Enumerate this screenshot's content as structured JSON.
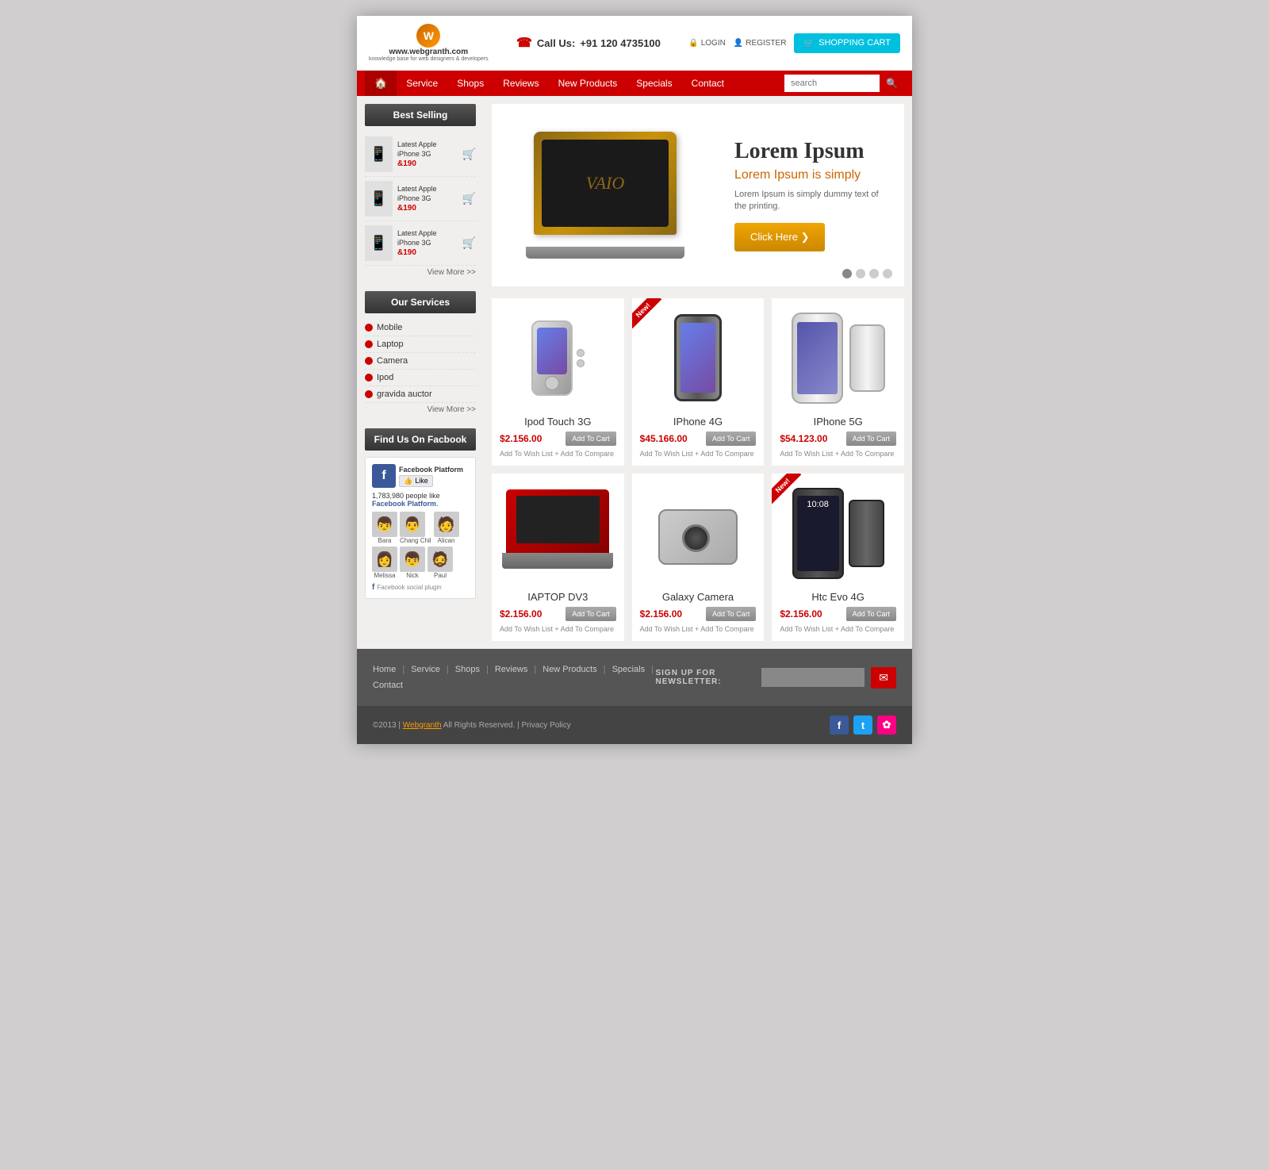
{
  "site": {
    "url": "www.webgranth.com",
    "tagline": "knowledge base for web designers & developers"
  },
  "header": {
    "phone_label": "Call Us:",
    "phone_number": "+91 120 4735100",
    "login_label": "LOGIN",
    "register_label": "REGISTER",
    "cart_label": "SHOPPING CART"
  },
  "nav": {
    "home_icon": "🏠",
    "items": [
      {
        "label": "Service"
      },
      {
        "label": "Shops"
      },
      {
        "label": "Reviews"
      },
      {
        "label": "New Products"
      },
      {
        "label": "Specials"
      },
      {
        "label": "Contact"
      }
    ],
    "search_placeholder": "search"
  },
  "sidebar": {
    "best_selling_title": "Best Selling",
    "products": [
      {
        "name": "Latest Apple iPhone 3G",
        "price": "&190"
      },
      {
        "name": "Latest Apple iPhone 3G",
        "price": "&190"
      },
      {
        "name": "Latest Apple iPhone 3G",
        "price": "&190"
      }
    ],
    "view_more_label": "View More >>",
    "services_title": "Our Services",
    "services": [
      {
        "label": "Mobile"
      },
      {
        "label": "Laptop"
      },
      {
        "label": "Camera"
      },
      {
        "label": "Ipod"
      },
      {
        "label": "gravida auctor"
      }
    ],
    "services_view_more": "View More >>",
    "facebook_section_title": "Find Us On Facbook",
    "facebook": {
      "platform_name": "Facebook Platform",
      "like_label": "Like",
      "count_text": "1,783,980 people like",
      "platform_bold": "Facebook Platform",
      "count_suffix": ".",
      "users": [
        {
          "name": "Bara"
        },
        {
          "name": "Chang Chil"
        },
        {
          "name": "Alican"
        },
        {
          "name": "Melissa"
        },
        {
          "name": "Nick"
        },
        {
          "name": "Paul"
        }
      ],
      "social_plugin_label": "Facebook social plugin"
    }
  },
  "slider": {
    "title": "Lorem Ipsum",
    "subtitle": "Lorem Ipsum is simply",
    "description": "Lorem Ipsum is simply dummy text of the printing.",
    "button_label": "Click Here ❯",
    "laptop_logo": "VAIO",
    "dots": [
      true,
      false,
      false,
      false
    ]
  },
  "products": [
    {
      "id": 1,
      "name": "Ipod Touch 3G",
      "price": "$2.156.00",
      "is_new": false,
      "type": "ipod",
      "add_to_cart": "Add To Cart",
      "wish_list": "Add To Wish List",
      "compare": "+ Add To Compare"
    },
    {
      "id": 2,
      "name": "IPhone 4G",
      "price": "$45.166.00",
      "is_new": true,
      "type": "iphone4",
      "add_to_cart": "Add To Cart",
      "wish_list": "Add To Wish List",
      "compare": "+ Add To Compare"
    },
    {
      "id": 3,
      "name": "IPhone 5G",
      "price": "$54.123.00",
      "is_new": false,
      "type": "iphone5",
      "add_to_cart": "Add To Cart",
      "wish_list": "Add To Wish List",
      "compare": "+ Add To Compare"
    },
    {
      "id": 4,
      "name": "IAPTOP DV3",
      "price": "$2.156.00",
      "is_new": false,
      "type": "laptop",
      "add_to_cart": "Add To Cart",
      "wish_list": "Add To Wish List",
      "compare": "+ Add To Compare"
    },
    {
      "id": 5,
      "name": "Galaxy Camera",
      "price": "$2.156.00",
      "is_new": false,
      "type": "camera",
      "add_to_cart": "Add To Cart",
      "wish_list": "Add To Wish List",
      "compare": "+ Add To Compare"
    },
    {
      "id": 6,
      "name": "Htc Evo 4G",
      "price": "$2.156.00",
      "is_new": true,
      "type": "htc",
      "add_to_cart": "Add To Cart",
      "wish_list": "Add To Wish List",
      "compare": "+ Add To Compare"
    }
  ],
  "footer": {
    "links": [
      "Home",
      "Service",
      "Shops",
      "Reviews",
      "New Products",
      "Specials",
      "Contact"
    ],
    "newsletter_label": "SIGN UP FOR NEWSLETTER:",
    "newsletter_placeholder": "",
    "newsletter_btn_icon": "✉",
    "copyright": "©2013 | Webgranth All Rights Reserved. | Privacy Policy",
    "social": [
      {
        "name": "facebook",
        "label": "f"
      },
      {
        "name": "twitter",
        "label": "t"
      },
      {
        "name": "flickr",
        "label": "✿"
      }
    ]
  }
}
